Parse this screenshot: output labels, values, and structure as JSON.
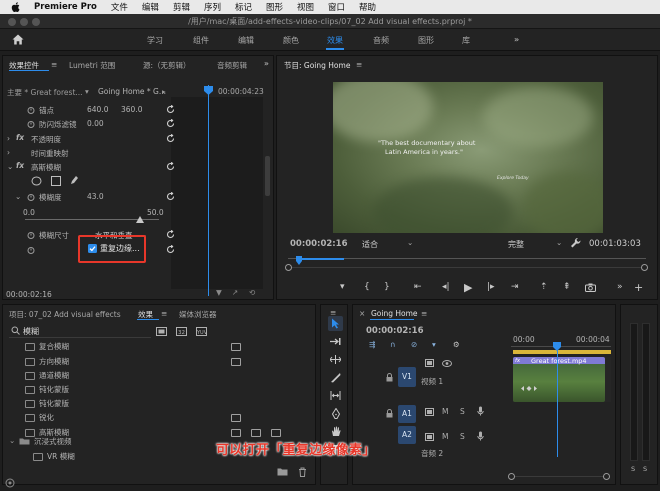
{
  "menubar": {
    "app_name": "Premiere Pro",
    "items": [
      "文件",
      "编辑",
      "剪辑",
      "序列",
      "标记",
      "图形",
      "视图",
      "窗口",
      "帮助"
    ]
  },
  "titlebar": {
    "path": "/用户/mac/桌面/add-effects-video-clips/07_02 Add visual effects.prproj *"
  },
  "workspaces": {
    "tabs": [
      "学习",
      "组件",
      "编辑",
      "颜色",
      "效果",
      "音频",
      "图形",
      "库"
    ],
    "active": "效果",
    "more": "»"
  },
  "effect_controls": {
    "tabs": [
      "效果控件",
      "Lumetri 范围",
      "源:（无剪辑）",
      "音频剪辑"
    ],
    "master_clip": "主要 * Great forest...",
    "sequence_clip": "Going Home * G...",
    "timecode_ruler": "00:00:04:23",
    "anchor_label": "锚点",
    "anchor_x": "640.0",
    "anchor_y": "360.0",
    "flicker_label": "防闪烁滤镜",
    "flicker_value": "0.00",
    "opacity_label": "不透明度",
    "time_remap_label": "时间重映射",
    "blur_label": "高斯模糊",
    "blurriness_label": "模糊度",
    "blurriness_value": "43.0",
    "slider_min": "0.0",
    "slider_max": "50.0",
    "blur_dimensions_label": "模糊尺寸",
    "blur_dimensions_value": "水平和垂直",
    "repeat_edge_label": "重复边缘...",
    "repeat_edge_checked": true,
    "current_time": "00:00:02:16"
  },
  "program_monitor": {
    "title": "节目: Going Home",
    "overlay_line1": "\"The best documentary about",
    "overlay_line2": "Latin America in years.\"",
    "overlay_credit": "Explore Today",
    "current_time": "00:00:02:16",
    "fit": "适合",
    "quality": "完整",
    "duration": "00:01:03:03"
  },
  "project_panel": {
    "tabs": [
      "项目: 07_02 Add visual effects",
      "效果",
      "媒体浏览器"
    ],
    "search_value": "模糊",
    "items": [
      {
        "label": "复合模糊",
        "badges": 1
      },
      {
        "label": "方向模糊",
        "badges": 1
      },
      {
        "label": "通道模糊",
        "badges": 0
      },
      {
        "label": "钝化蒙版",
        "badges": 0
      },
      {
        "label": "钝化蒙版",
        "badges": 0
      },
      {
        "label": "锐化",
        "badges": 1
      },
      {
        "label": "高斯模糊",
        "badges": 3
      }
    ],
    "folder_label": "沉浸式视频",
    "vr_item": "VR 模糊"
  },
  "timeline": {
    "title": "Going Home",
    "current_time": "00:00:02:16",
    "ruler_start": "00:00",
    "ruler_mid": "00:00:04",
    "v1_label": "V1",
    "v1_name": "视频 1",
    "a1_label": "A1",
    "a2_label": "A2",
    "a2_name": "音频 2",
    "clip_label": "Great forest.mp4",
    "toggles": [
      "M",
      "S"
    ],
    "meter_labels": [
      "S",
      "S"
    ]
  },
  "caption": "可以打开「重复边缘像素」",
  "colors": {
    "accent": "#2d8ceb",
    "highlight": "#e8372a",
    "caption": "#e8372a"
  }
}
